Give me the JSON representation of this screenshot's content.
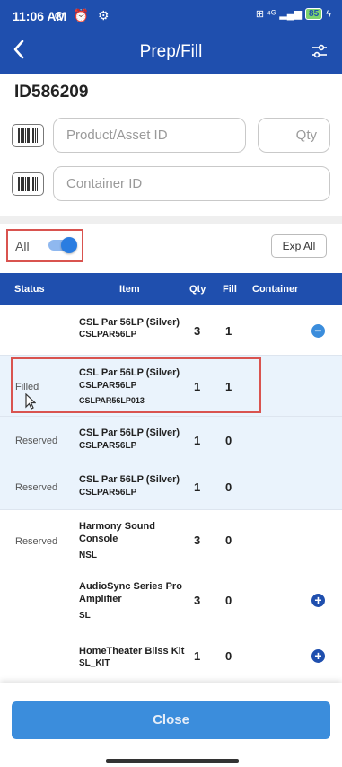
{
  "statusbar": {
    "time": "11:06 AM",
    "left_icons": "⊘ ⏰ ⚙",
    "net": "⊞ ⁴ᴳ",
    "battery": "85",
    "colors": {
      "bar": "#1f4fae"
    }
  },
  "appbar": {
    "title": "Prep/Fill",
    "back_icon": "chevron-left-icon",
    "filter_icon": "sliders-icon"
  },
  "record_id": "ID586209",
  "inputs": {
    "product_placeholder": "Product/Asset ID",
    "qty_placeholder": "Qty",
    "container_placeholder": "Container ID"
  },
  "filter": {
    "all_label": "All",
    "all_toggle_on": true,
    "exp_all_label": "Exp All"
  },
  "table": {
    "headers": {
      "status": "Status",
      "item": "Item",
      "qty": "Qty",
      "fill": "Fill",
      "container": "Container"
    },
    "rows": [
      {
        "status": "",
        "name": "CSL Par 56LP (Silver)",
        "code": "CSLPAR56LP",
        "serial": "",
        "qty": "3",
        "fill": "1",
        "action": "minus"
      },
      {
        "status": "Filled",
        "name": "CSL Par 56LP (Silver)",
        "code": "CSLPAR56LP",
        "serial": "CSLPAR56LP013",
        "qty": "1",
        "fill": "1",
        "action": ""
      },
      {
        "status": "Reserved",
        "name": "CSL Par 56LP (Silver)",
        "code": "CSLPAR56LP",
        "serial": "",
        "qty": "1",
        "fill": "0",
        "action": ""
      },
      {
        "status": "Reserved",
        "name": "CSL Par 56LP (Silver)",
        "code": "CSLPAR56LP",
        "serial": "",
        "qty": "1",
        "fill": "0",
        "action": ""
      },
      {
        "status": "Reserved",
        "name": "Harmony Sound Console",
        "code": "NSL",
        "serial": "",
        "qty": "3",
        "fill": "0",
        "action": ""
      },
      {
        "status": "",
        "name": "AudioSync Series Pro Amplifier",
        "code": "SL",
        "serial": "",
        "qty": "3",
        "fill": "0",
        "action": "plus"
      },
      {
        "status": "",
        "name": "HomeTheater Bliss Kit",
        "code": "SL_KIT",
        "serial": "",
        "qty": "1",
        "fill": "0",
        "action": "plus"
      }
    ]
  },
  "footer": {
    "close_label": "Close"
  }
}
